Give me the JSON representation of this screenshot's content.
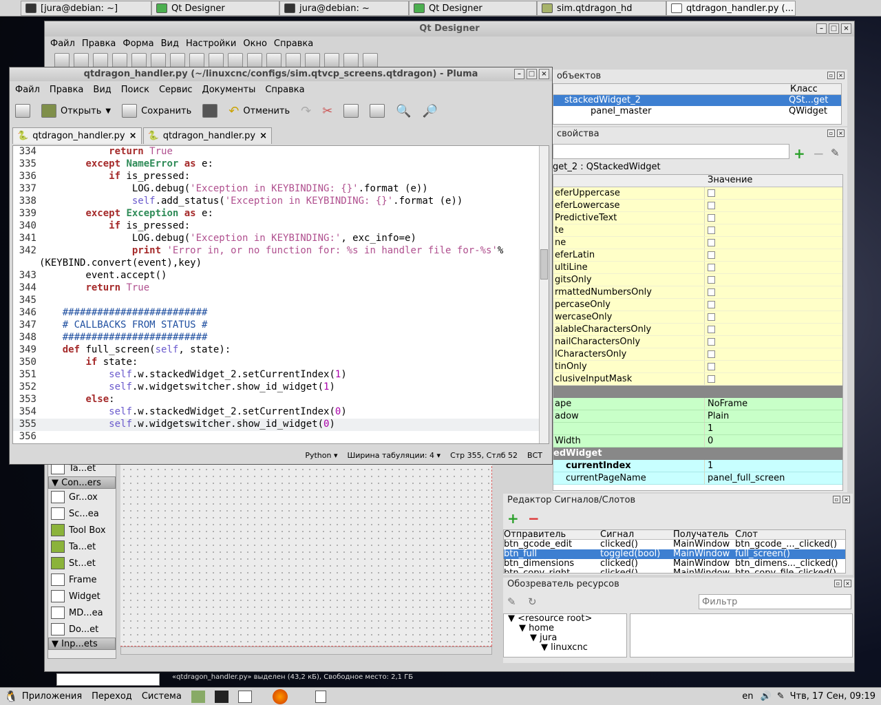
{
  "taskbar": [
    {
      "label": "[jura@debian: ~]"
    },
    {
      "label": "Qt Designer"
    },
    {
      "label": "jura@debian: ~"
    },
    {
      "label": "Qt Designer"
    },
    {
      "label": "sim.qtdragon_hd"
    },
    {
      "label": "qtdragon_handler.py (..."
    }
  ],
  "qtd": {
    "title": "Qt Designer",
    "menu": [
      "Файл",
      "Правка",
      "Форма",
      "Вид",
      "Настройки",
      "Окно",
      "Справка"
    ],
    "obj_inspector_title": "объектов",
    "obj_col_class": "Класс",
    "obj_rows": [
      {
        "name": "stackedWidget_2",
        "cls": "QSt...get"
      },
      {
        "name": "panel_master",
        "cls": "QWidget"
      }
    ],
    "prop_title": "свойства",
    "prop_object": "get_2 : QStackedWidget",
    "prop_col_value": "Значение",
    "props_yellow": [
      "eferUppercase",
      "eferLowercase",
      "PredictiveText",
      "te",
      "ne",
      "eferLatin",
      "ultiLine",
      "gitsOnly",
      "rmattedNumbersOnly",
      "percaseOnly",
      "wercaseOnly",
      "alableCharactersOnly",
      "nailCharactersOnly",
      "lCharactersOnly",
      "tinOnly",
      "clusiveInputMask"
    ],
    "props_green": [
      {
        "name": "ape",
        "value": "NoFrame"
      },
      {
        "name": "adow",
        "value": "Plain"
      },
      {
        "name": "",
        "value": "1"
      },
      {
        "name": "Width",
        "value": "0"
      }
    ],
    "props_section": "edWidget",
    "props_cyan": [
      {
        "name": "currentIndex",
        "value": "1"
      },
      {
        "name": "currentPageName",
        "value": "panel_full_screen"
      }
    ],
    "sig_title": "Редактор Сигналов/Слотов",
    "sig_cols": [
      "Отправитель",
      "Сигнал",
      "Получатель",
      "Слот"
    ],
    "sig_rows": [
      {
        "sender": "btn_gcode_edit",
        "signal": "clicked()",
        "receiver": "MainWindow",
        "slot": "btn_gcode_..._clicked()"
      },
      {
        "sender": "btn_full",
        "signal": "toggled(bool)",
        "receiver": "MainWindow",
        "slot": "full_screen()"
      },
      {
        "sender": "btn_dimensions",
        "signal": "clicked()",
        "receiver": "MainWindow",
        "slot": "btn_dimens..._clicked()"
      },
      {
        "sender": "btn_copy_right",
        "signal": "clicked()",
        "receiver": "MainWindow",
        "slot": "btn_copy_file_clicked()"
      }
    ],
    "res_title": "Обозреватель ресурсов",
    "res_filter_placeholder": "Фильтр",
    "res_tree": [
      "<resource root>",
      "home",
      "jura",
      "linuxcnc"
    ],
    "widget_box": {
      "top_item": "Ta...et",
      "cat_containers": "Con...ers",
      "items": [
        "Gr...ox",
        "Sc...ea",
        "Tool Box",
        "Ta...et",
        "St...et",
        "Frame",
        "Widget",
        "MD...ea",
        "Do...et"
      ],
      "cat_input": "Inp...ets"
    }
  },
  "pluma": {
    "title": "qtdragon_handler.py (~/linuxcnc/configs/sim.qtvcp_screens.qtdragon) - Pluma",
    "menu": [
      "Файл",
      "Правка",
      "Вид",
      "Поиск",
      "Сервис",
      "Документы",
      "Справка"
    ],
    "btn_open": "Открыть",
    "btn_save": "Сохранить",
    "btn_undo": "Отменить",
    "tabs": [
      "qtdragon_handler.py",
      "qtdragon_handler.py"
    ],
    "status": {
      "lang": "Python",
      "tab_width": "Ширина табуляции:  4",
      "pos": "Стр 355, Стлб 52",
      "mode": "ВСТ"
    }
  },
  "lines": [
    {
      "n": "334",
      "t": "            return True"
    },
    {
      "n": "335",
      "t": "        except NameError as e:"
    },
    {
      "n": "336",
      "t": "            if is_pressed:"
    },
    {
      "n": "337",
      "t": "                LOG.debug('Exception in KEYBINDING: {}'.format (e))"
    },
    {
      "n": "338",
      "t": "                self.add_status('Exception in KEYBINDING: {}'.format (e))"
    },
    {
      "n": "339",
      "t": "        except Exception as e:"
    },
    {
      "n": "340",
      "t": "            if is_pressed:"
    },
    {
      "n": "341",
      "t": "                LOG.debug('Exception in KEYBINDING:', exc_info=e)"
    },
    {
      "n": "342",
      "t": "                print 'Error in, or no function for: %s in handler file for-%s'%"
    },
    {
      "n": "",
      "t": "(KEYBIND.convert(event),key)"
    },
    {
      "n": "343",
      "t": "        event.accept()"
    },
    {
      "n": "344",
      "t": "        return True"
    },
    {
      "n": "345",
      "t": ""
    },
    {
      "n": "346",
      "t": "    #########################"
    },
    {
      "n": "347",
      "t": "    # CALLBACKS FROM STATUS #"
    },
    {
      "n": "348",
      "t": "    #########################"
    },
    {
      "n": "349",
      "t": "    def full_screen(self, state):"
    },
    {
      "n": "350",
      "t": "        if state:"
    },
    {
      "n": "351",
      "t": "            self.w.stackedWidget_2.setCurrentIndex(1)"
    },
    {
      "n": "352",
      "t": "            self.w.widgetswitcher.show_id_widget(1)"
    },
    {
      "n": "353",
      "t": "        else:"
    },
    {
      "n": "354",
      "t": "            self.w.stackedWidget_2.setCurrentIndex(0)"
    },
    {
      "n": "355",
      "t": "            self.w.widgetswitcher.show_id_widget(0)"
    },
    {
      "n": "356",
      "t": ""
    }
  ],
  "status_msg": "«qtdragon_handler.py» выделен (43,2 кБ), Свободное место: 2,1 ГБ",
  "bottom": {
    "apps": "Приложения",
    "go": "Переход",
    "system": "Система",
    "lang": "en",
    "clock": "Чтв, 17 Сен, 09:19"
  }
}
